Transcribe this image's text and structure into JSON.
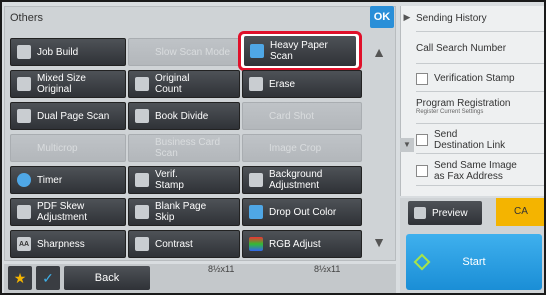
{
  "panel": {
    "title": "Others",
    "ok_label": "OK"
  },
  "functions": {
    "job_build": "Job Build",
    "slow_scan_mode": "Slow Scan Mode",
    "heavy_paper_scan": "Heavy Paper\nScan",
    "mixed_size_original": "Mixed Size\nOriginal",
    "original_count": "Original\nCount",
    "erase": "Erase",
    "dual_page_scan": "Dual Page Scan",
    "book_divide": "Book Divide",
    "card_shot": "Card Shot",
    "multicrop": "Multicrop",
    "business_card_scan": "Business Card\nScan",
    "image_crop": "Image Crop",
    "timer": "Timer",
    "verif_stamp": "Verif.\nStamp",
    "background_adjustment": "Background\nAdjustment",
    "pdf_skew_adjustment": "PDF Skew\nAdjustment",
    "blank_page_skip": "Blank Page\nSkip",
    "drop_out_color": "Drop Out Color",
    "sharpness": "Sharpness",
    "contrast": "Contrast",
    "rgb_adjust": "RGB Adjust"
  },
  "bottom": {
    "back_label": "Back",
    "paper_left": "8½x11",
    "paper_right": "8½x11"
  },
  "right_panel": {
    "sending_history": "Sending History",
    "call_search_number": "Call Search Number",
    "verification_stamp": "Verification Stamp",
    "program_registration": "Program Registration",
    "register_current_settings": "Register Current Settings",
    "send_destination_link": "Send\nDestination Link",
    "send_same_image_fax": "Send Same Image\nas Fax Address",
    "preview_label": "Preview",
    "ca_label": "CA",
    "start_label": "Start"
  },
  "colors": {
    "accent": "#2a8fd8",
    "highlight": "#e0102a",
    "ca": "#f4b400",
    "start": "#1a8ed6"
  }
}
